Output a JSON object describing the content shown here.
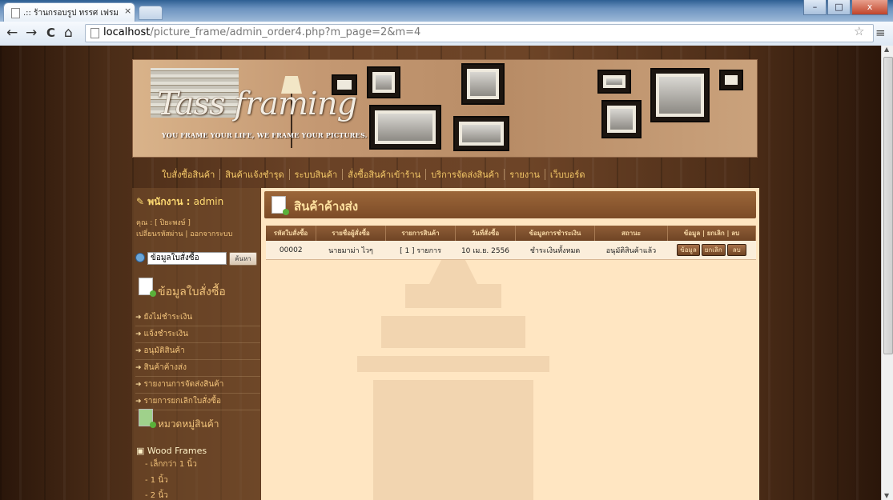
{
  "browser": {
    "tab_title": ".:: ร้านกรอบรูป ทรรศ เฟรมมิ่ง ::.",
    "tab_close": "×",
    "url_host": "localhost",
    "url_path": "/picture_frame/admin_order4.php?m_page=2&m=4",
    "back": "←",
    "forward": "→",
    "reload": "C",
    "home": "⌂",
    "star": "☆",
    "menu": "≡",
    "minimize": "–",
    "maximize": "□",
    "close": "x"
  },
  "banner": {
    "logo": "Tass framing",
    "tagline": "YOU FRAME YOUR LIFE, WE FRAME YOUR PICTURES."
  },
  "topnav": [
    "ใบสั่งซื้อสินค้า",
    "สินค้าแจ้งชำรุด",
    "ระบบสินค้า",
    "สั่งซื้อสินค้าเข้าร้าน",
    "บริการจัดส่งสินค้า",
    "รายงาน",
    "เว็บบอร์ด"
  ],
  "sidebar": {
    "staff_label": "พนักงาน :",
    "staff_name": "admin",
    "user_line": "คุณ : [ ปิยะพงษ์ ]",
    "account_line": "เปลี่ยนรหัสผ่าน | ออกจากระบบ",
    "search_value": "ข้อมูลใบสั่งซื้อ",
    "search_button": "ค้นหา",
    "order_heading": "ข้อมูลใบสั่งซื้อ",
    "links": [
      "ยังไม่ชำระเงิน",
      "แจ้งชำระเงิน",
      "อนุมัติสินค้า",
      "สินค้าค้างส่ง",
      "รายงานการจัดส่งสินค้า",
      "รายการยกเลิกใบสั่งซื้อ"
    ],
    "category_heading": "หมวดหมู่สินค้า",
    "category": "Wood Frames",
    "subcategories": [
      "- เล็กกว่า 1 นิ้ว",
      "- 1 นิ้ว",
      "- 2 นิ้ว"
    ]
  },
  "main": {
    "title": "สินค้าค้างส่ง",
    "columns": [
      "รหัสใบสั่งซื้อ",
      "รายชื่อผู้สั่งซื้อ",
      "รายการสินค้า",
      "วันที่สั่งซื้อ",
      "ข้อมูลการชำระเงิน",
      "สถานะ",
      "ข้อมูล | ยกเลิก | ลบ"
    ],
    "rows": [
      {
        "id": "00002",
        "customer": "นายมาม่า ไวๆ",
        "items": "[ 1 ] รายการ",
        "date": "10 เม.ย. 2556",
        "payment": "ชำระเงินทั้งหมด",
        "status": "อนุมัติสินค้าแล้ว",
        "btn_info": "ข้อมูล",
        "btn_cancel": "ยกเลิก",
        "btn_delete": "ลบ"
      }
    ]
  },
  "colors": {
    "accent_gold": "#f0c76a",
    "paid_blue": "#2a44d8",
    "status_orange": "#e67a1c",
    "panel_bg": "#ffe6c2"
  }
}
